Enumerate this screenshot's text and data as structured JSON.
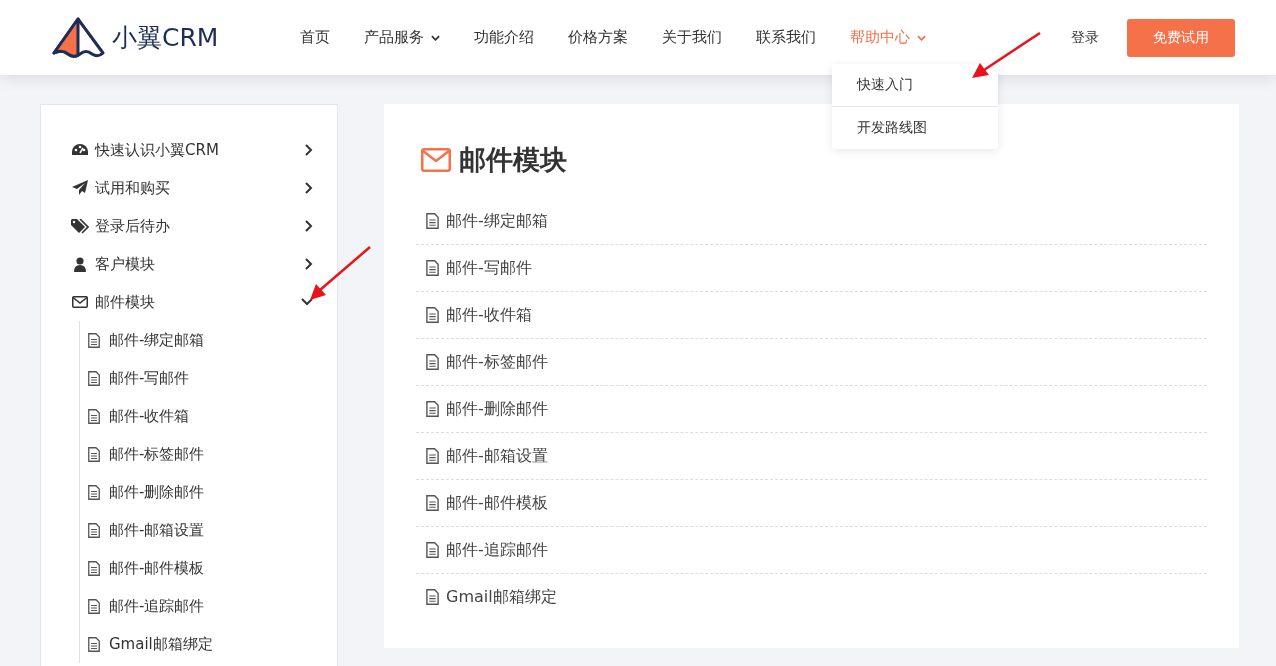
{
  "brand": {
    "name": "小翼CRM"
  },
  "nav": [
    {
      "label": "首页",
      "selected": false,
      "has_menu": false
    },
    {
      "label": "产品服务",
      "selected": false,
      "has_menu": true
    },
    {
      "label": "功能介绍",
      "selected": false,
      "has_menu": false
    },
    {
      "label": "价格方案",
      "selected": false,
      "has_menu": false
    },
    {
      "label": "关于我们",
      "selected": false,
      "has_menu": false
    },
    {
      "label": "联系我们",
      "selected": false,
      "has_menu": false
    },
    {
      "label": "帮助中心",
      "selected": true,
      "has_menu": true,
      "menu": [
        "快速入门",
        "开发路线图"
      ]
    }
  ],
  "login": "登录",
  "cta": "免费试用",
  "sidebar": [
    {
      "label": "快速认识小翼CRM",
      "kind": "dashboard",
      "expanded": false
    },
    {
      "label": "试用和购买",
      "kind": "plane",
      "expanded": false
    },
    {
      "label": "登录后待办",
      "kind": "tags",
      "expanded": false
    },
    {
      "label": "客户模块",
      "kind": "user",
      "expanded": false
    },
    {
      "label": "邮件模块",
      "kind": "envelope",
      "expanded": true,
      "children": [
        "邮件-绑定邮箱",
        "邮件-写邮件",
        "邮件-收件箱",
        "邮件-标签邮件",
        "邮件-删除邮件",
        "邮件-邮箱设置",
        "邮件-邮件模板",
        "邮件-追踪邮件",
        "Gmail邮箱绑定"
      ]
    }
  ],
  "content": {
    "title": "邮件模块",
    "articles": [
      "邮件-绑定邮箱",
      "邮件-写邮件",
      "邮件-收件箱",
      "邮件-标签邮件",
      "邮件-删除邮件",
      "邮件-邮箱设置",
      "邮件-邮件模板",
      "邮件-追踪邮件",
      "Gmail邮箱绑定"
    ]
  }
}
